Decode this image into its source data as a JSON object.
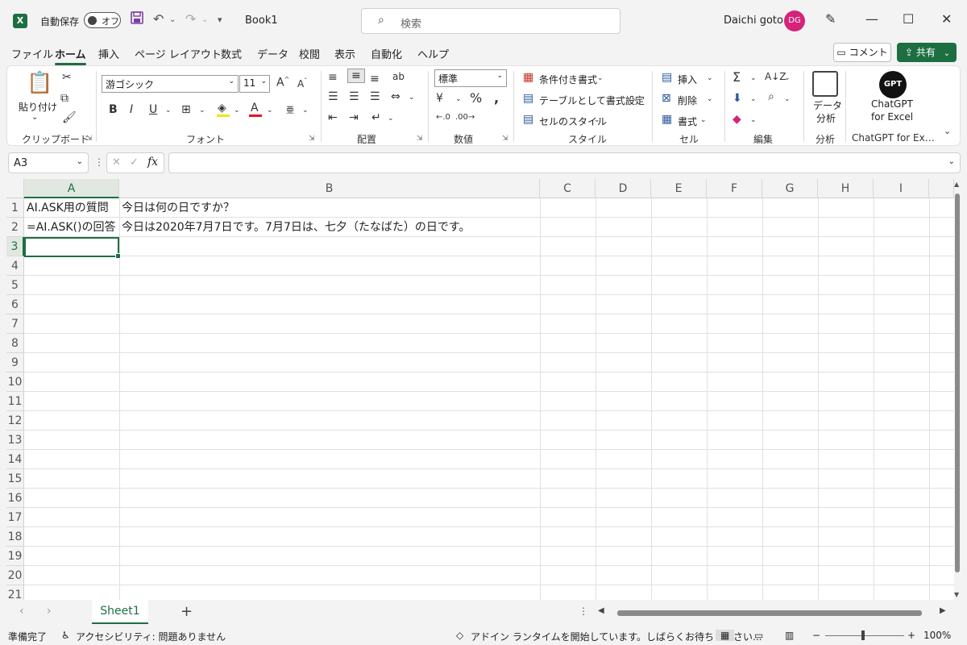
{
  "titlebar": {
    "app_icon": "excel-icon",
    "autosave_label": "自動保存",
    "autosave_state": "オフ",
    "doc_title": "Book1",
    "search_placeholder": "検索",
    "user_name": "Daichi goto",
    "user_initials": "DG",
    "avatar_color": "#d6237a"
  },
  "menu": {
    "items": [
      "ファイル",
      "ホーム",
      "挿入",
      "ページ レイアウト",
      "数式",
      "データ",
      "校閲",
      "表示",
      "自動化",
      "ヘルプ"
    ],
    "active": "ホーム",
    "comment_label": "コメント",
    "share_label": "共有"
  },
  "ribbon": {
    "clipboard": {
      "paste_label": "貼り付け",
      "group_label": "クリップボード"
    },
    "font": {
      "font_name": "游ゴシック",
      "font_size": "11",
      "group_label": "フォント",
      "bold": "B",
      "italic": "I",
      "underline": "U"
    },
    "alignment": {
      "group_label": "配置"
    },
    "number": {
      "format": "標準",
      "group_label": "数値"
    },
    "styles": {
      "conditional": "条件付き書式",
      "table": "テーブルとして書式設定",
      "cell_styles": "セルのスタイル",
      "group_label": "スタイル"
    },
    "cells": {
      "insert": "挿入",
      "delete": "削除",
      "format": "書式",
      "group_label": "セル"
    },
    "editing": {
      "group_label": "編集"
    },
    "analysis": {
      "button_label_1": "データ",
      "button_label_2": "分析",
      "group_label": "分析"
    },
    "chatgpt": {
      "icon_text": "GPT",
      "button_label_1": "ChatGPT",
      "button_label_2": "for Excel",
      "group_label": "ChatGPT for Ex…"
    }
  },
  "formula_bar": {
    "name_box": "A3",
    "formula": ""
  },
  "grid": {
    "columns": [
      "A",
      "B",
      "C",
      "D",
      "E",
      "F",
      "G",
      "H",
      "I"
    ],
    "rows": [
      "1",
      "2",
      "3",
      "4",
      "5",
      "6",
      "7",
      "8",
      "9",
      "10",
      "11",
      "12",
      "13",
      "14",
      "15",
      "16",
      "17",
      "18",
      "19",
      "20",
      "21"
    ],
    "cells": {
      "A1": "AI.ASK用の質問",
      "B1": "今日は何の日ですか？",
      "A2": "=AI.ASK()の回答",
      "B2": "今日は2020年7月7日です。7月7日は、七夕（たなばた）の日です。"
    },
    "active_cell": "A3",
    "accent": "#1d6f42"
  },
  "sheets": {
    "tabs": [
      "Sheet1"
    ],
    "active": "Sheet1"
  },
  "status": {
    "ready": "準備完了",
    "accessibility": "アクセシビリティ: 問題ありません",
    "addin_message": "アドイン ランタイムを開始しています。しばらくお待ちください...",
    "zoom": "100%"
  }
}
